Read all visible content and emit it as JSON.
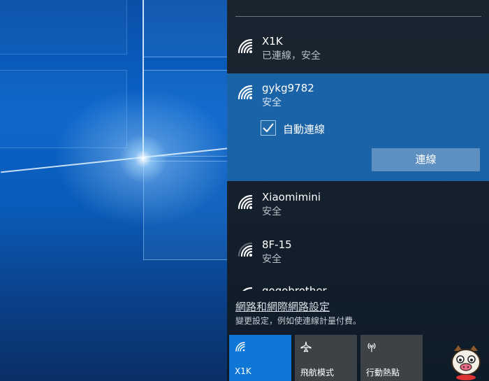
{
  "networks": [
    {
      "name": "X1K",
      "status": "已連線，安全"
    },
    {
      "name": "gykg9782",
      "status": "安全",
      "auto_connect_label": "自動連線",
      "connect_button": "連線"
    },
    {
      "name": "Xiaomimini",
      "status": "安全"
    },
    {
      "name": "8F-15",
      "status": "安全"
    },
    {
      "name": "gogobrother"
    }
  ],
  "settings": {
    "link": "網路和網際網路設定",
    "description": "變更設定，例如使連線計量付費。"
  },
  "quick_actions": [
    {
      "label": "X1K",
      "icon": "wifi-icon",
      "active": true
    },
    {
      "label": "飛航模式",
      "icon": "airplane-icon",
      "active": false
    },
    {
      "label": "行動熱點",
      "icon": "hotspot-icon",
      "active": false
    }
  ],
  "colors": {
    "selected_bg": "#1a63a6",
    "active_tile": "#0f78d7",
    "inactive_tile": "#3c4246",
    "connect_button": "#5d8fc0"
  }
}
